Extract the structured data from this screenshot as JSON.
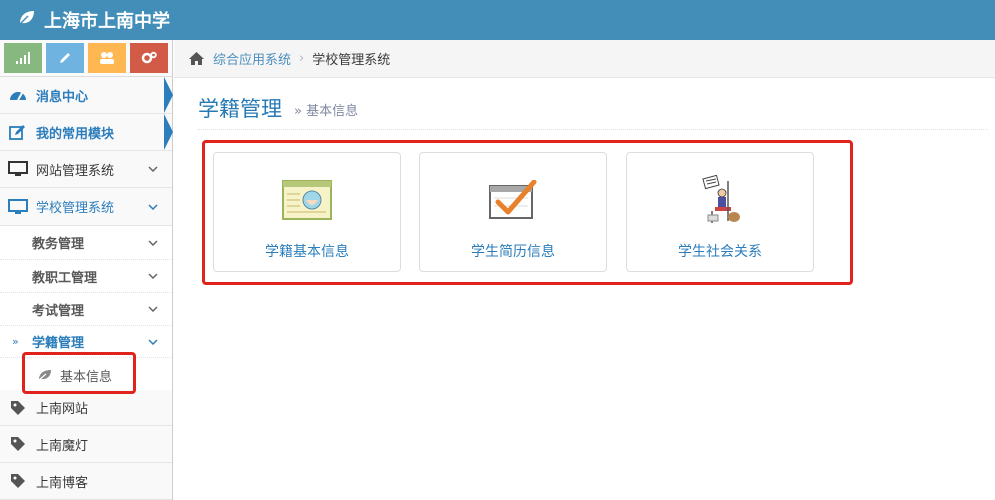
{
  "header": {
    "brand": "上海市上南中学"
  },
  "shortcuts": [
    "signal-icon",
    "pencil-icon",
    "users-icon",
    "cogs-icon"
  ],
  "sidebar": {
    "items": [
      {
        "label": "消息中心",
        "icon": "dashboard-icon"
      },
      {
        "label": "我的常用模块",
        "icon": "edit-icon"
      },
      {
        "label": "网站管理系统",
        "icon": "desktop-icon"
      },
      {
        "label": "学校管理系统",
        "icon": "desktop-icon"
      }
    ],
    "sub_items": [
      {
        "label": "教务管理"
      },
      {
        "label": "教职工管理"
      },
      {
        "label": "考试管理"
      },
      {
        "label": "学籍管理"
      }
    ],
    "leaf": {
      "label": "基本信息",
      "icon": "leaf-icon"
    },
    "bottom_items": [
      {
        "label": "上南网站",
        "icon": "tag-icon"
      },
      {
        "label": "上南魔灯",
        "icon": "tag-icon"
      },
      {
        "label": "上南博客",
        "icon": "tag-icon"
      }
    ],
    "sub_marker": "»"
  },
  "breadcrumb": {
    "home_icon": "home-icon",
    "link": "综合应用系统",
    "sep": "›",
    "current": "学校管理系统"
  },
  "page": {
    "title": "学籍管理",
    "subtitle": "» 基本信息"
  },
  "cards": [
    {
      "label": "学籍基本信息",
      "icon": "student-card-icon"
    },
    {
      "label": "学生简历信息",
      "icon": "checkmark-board-icon"
    },
    {
      "label": "学生社会关系",
      "icon": "social-relations-icon"
    }
  ],
  "colors": {
    "topbar": "#438eb9",
    "accent": "#2b7dbc",
    "highlight": "#e0231d"
  }
}
